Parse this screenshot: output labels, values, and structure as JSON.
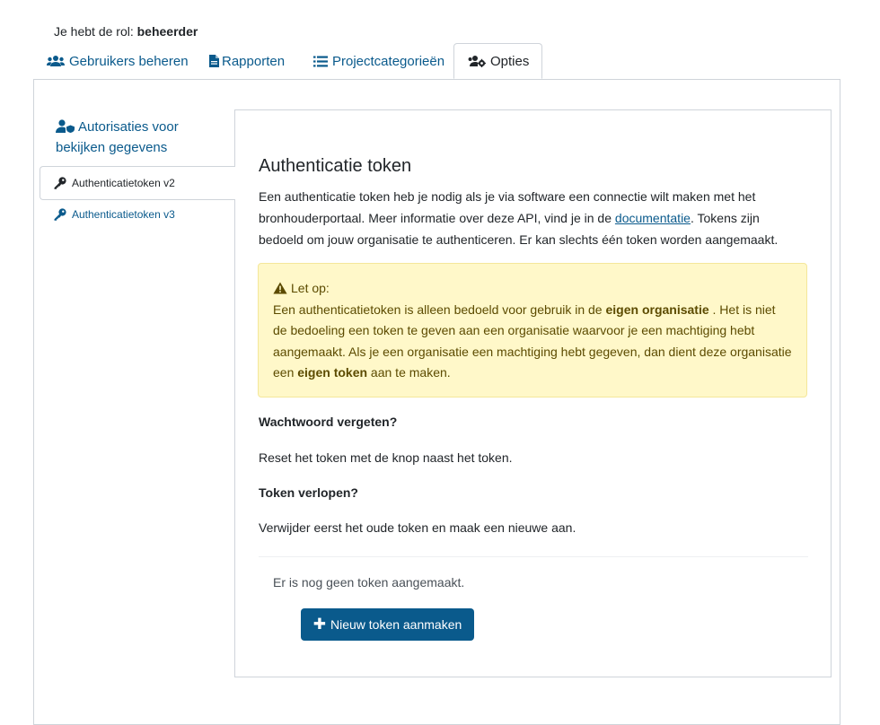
{
  "role": {
    "prefix": "Je hebt de rol:",
    "value": "beheerder"
  },
  "tabs": [
    {
      "label": "Gebruikers beheren",
      "icon": "users-icon"
    },
    {
      "label": "Rapporten",
      "icon": "file-icon"
    },
    {
      "label": "Projectcategorieën",
      "icon": "list-icon"
    },
    {
      "label": "Opties",
      "icon": "users-gear-icon",
      "active": true
    }
  ],
  "sidenav": {
    "items": [
      {
        "label": "Autorisaties voor bekijken gegevens",
        "icon": "user-shield-icon"
      },
      {
        "label": "Authenticatietoken v2",
        "icon": "key-icon",
        "active": true
      },
      {
        "label": "Authenticatietoken v3",
        "icon": "key-icon"
      }
    ]
  },
  "content": {
    "title": "Authenticatie token",
    "intro_1": "Een authenticatie token heb je nodig als je via software een connectie wilt maken met het bronhouderportaal. Meer informatie over deze API, vind je in de ",
    "intro_link": "documentatie",
    "intro_2": ". Tokens zijn bedoeld om jouw organisatie te authenticeren. Er kan slechts één token worden aangemaakt.",
    "alert": {
      "heading": "Let op:",
      "text_1": "Een authenticatietoken is alleen bedoeld voor gebruik in de ",
      "bold_1": "eigen organisatie",
      "text_2": " . Het is niet de bedoeling een token te geven aan een organisatie waarvoor je een machtiging hebt aangemaakt. Als je een organisatie een machtiging hebt gegeven, dan dient deze organisatie een ",
      "bold_2": "eigen token",
      "text_3": " aan te maken."
    },
    "forgot_heading": "Wachtwoord vergeten?",
    "forgot_text": "Reset het token met de knop naast het token.",
    "expired_heading": "Token verlopen?",
    "expired_text": "Verwijder eerst het oude token en maak een nieuwe aan.",
    "no_token_text": "Er is nog geen token aangemaakt.",
    "new_button": "Nieuw token aanmaken"
  },
  "colors": {
    "accent": "#0a5a8c",
    "alert_bg": "#fff8c9",
    "alert_text": "#5c4b00",
    "border": "#cfd4da"
  }
}
